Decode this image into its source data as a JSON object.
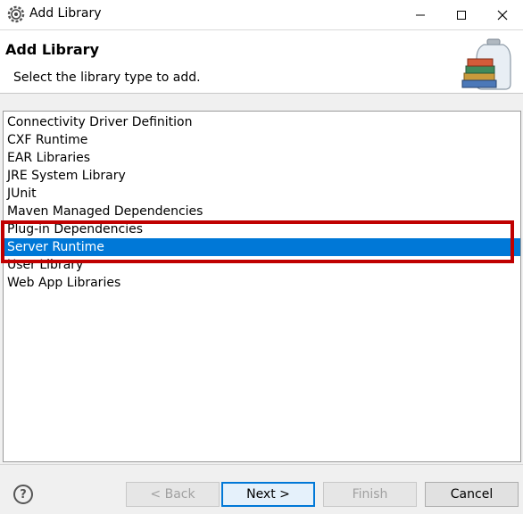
{
  "window": {
    "title": "Add Library",
    "app_icon": "eclipse-gear-icon",
    "controls": [
      "minimize-icon",
      "maximize-icon",
      "close-icon"
    ]
  },
  "header": {
    "title": "Add Library",
    "description": "Select the library type to add.",
    "icon": "library-jar-books-icon"
  },
  "library_list": {
    "items": [
      "Connectivity Driver Definition",
      "CXF Runtime",
      "EAR Libraries",
      "JRE System Library",
      "JUnit",
      "Maven Managed Dependencies",
      "Plug-in Dependencies",
      "Server Runtime",
      "User Library",
      "Web App Libraries"
    ],
    "selected": "Server Runtime",
    "selection_color": "#0078d7",
    "annotation_color": "#c00000"
  },
  "footer": {
    "help_icon": "help-icon",
    "help_glyph": "?",
    "back_label": "< Back",
    "next_label": "Next >",
    "finish_label": "Finish",
    "cancel_label": "Cancel"
  }
}
